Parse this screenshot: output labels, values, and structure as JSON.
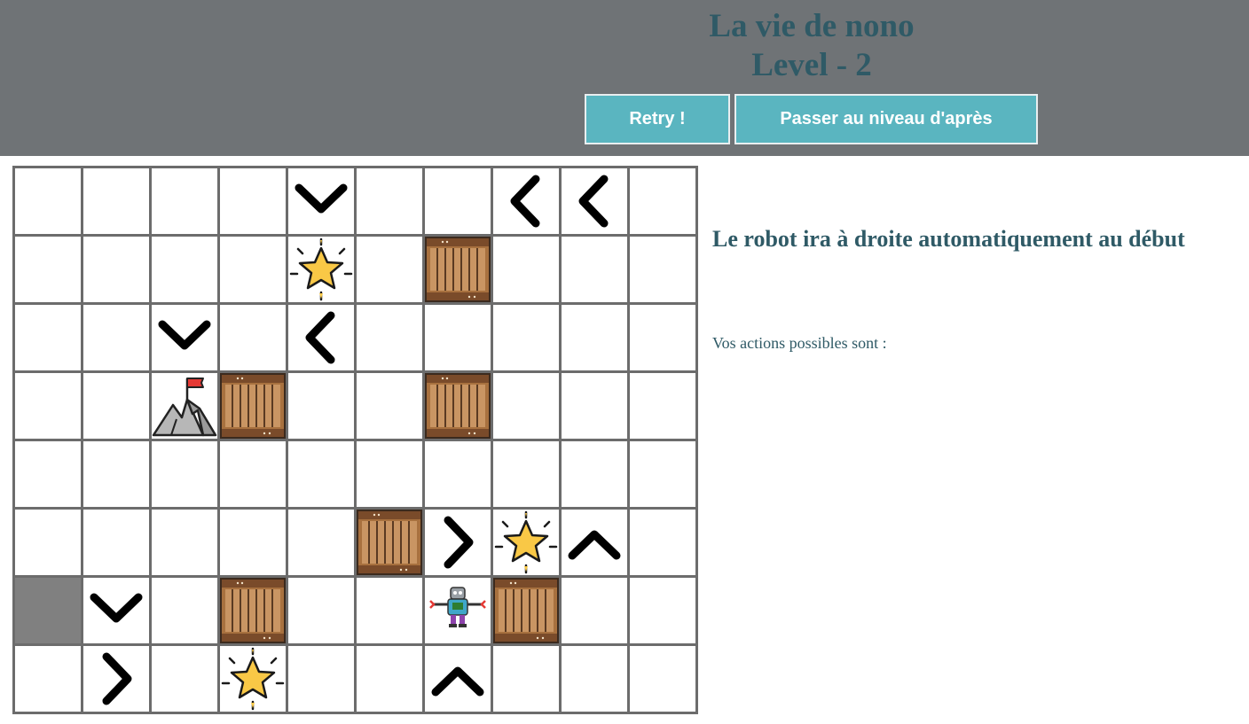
{
  "header": {
    "title_line1": "La vie de nono",
    "title_line2": "Level - 2",
    "retry_label": "Retry !",
    "next_label": "Passer au niveau d'après"
  },
  "info": {
    "title": "Le robot ira à droite automatiquement au début",
    "actions_label": "Vos actions possibles sont :"
  },
  "board": {
    "cols": 10,
    "rows": 8,
    "cells": [
      [
        "empty",
        "empty",
        "empty",
        "empty",
        "arrow-down",
        "empty",
        "empty",
        "arrow-left",
        "arrow-left",
        "empty"
      ],
      [
        "empty",
        "empty",
        "empty",
        "empty",
        "star",
        "empty",
        "crate",
        "empty",
        "empty",
        "empty"
      ],
      [
        "empty",
        "empty",
        "arrow-down",
        "empty",
        "arrow-left",
        "empty",
        "empty",
        "empty",
        "empty",
        "empty"
      ],
      [
        "empty",
        "empty",
        "goal-flag",
        "crate",
        "empty",
        "empty",
        "crate",
        "empty",
        "empty",
        "empty"
      ],
      [
        "empty",
        "empty",
        "empty",
        "empty",
        "empty",
        "empty",
        "empty",
        "empty",
        "empty",
        "empty"
      ],
      [
        "empty",
        "empty",
        "empty",
        "empty",
        "empty",
        "crate",
        "arrow-right",
        "star",
        "arrow-up",
        "empty"
      ],
      [
        "wall",
        "arrow-down",
        "empty",
        "crate",
        "empty",
        "empty",
        "robot",
        "crate",
        "empty",
        "empty"
      ],
      [
        "empty",
        "arrow-right",
        "empty",
        "star",
        "empty",
        "empty",
        "arrow-up",
        "empty",
        "empty",
        "empty"
      ]
    ]
  },
  "colors": {
    "header_bg": "#6f7376",
    "title_text": "#2f5a66",
    "button_bg": "#5ab5c0",
    "grid_line": "#6c6c6c",
    "wall": "#808080",
    "crate": "#8b5e3c",
    "star": "#f9c846"
  }
}
